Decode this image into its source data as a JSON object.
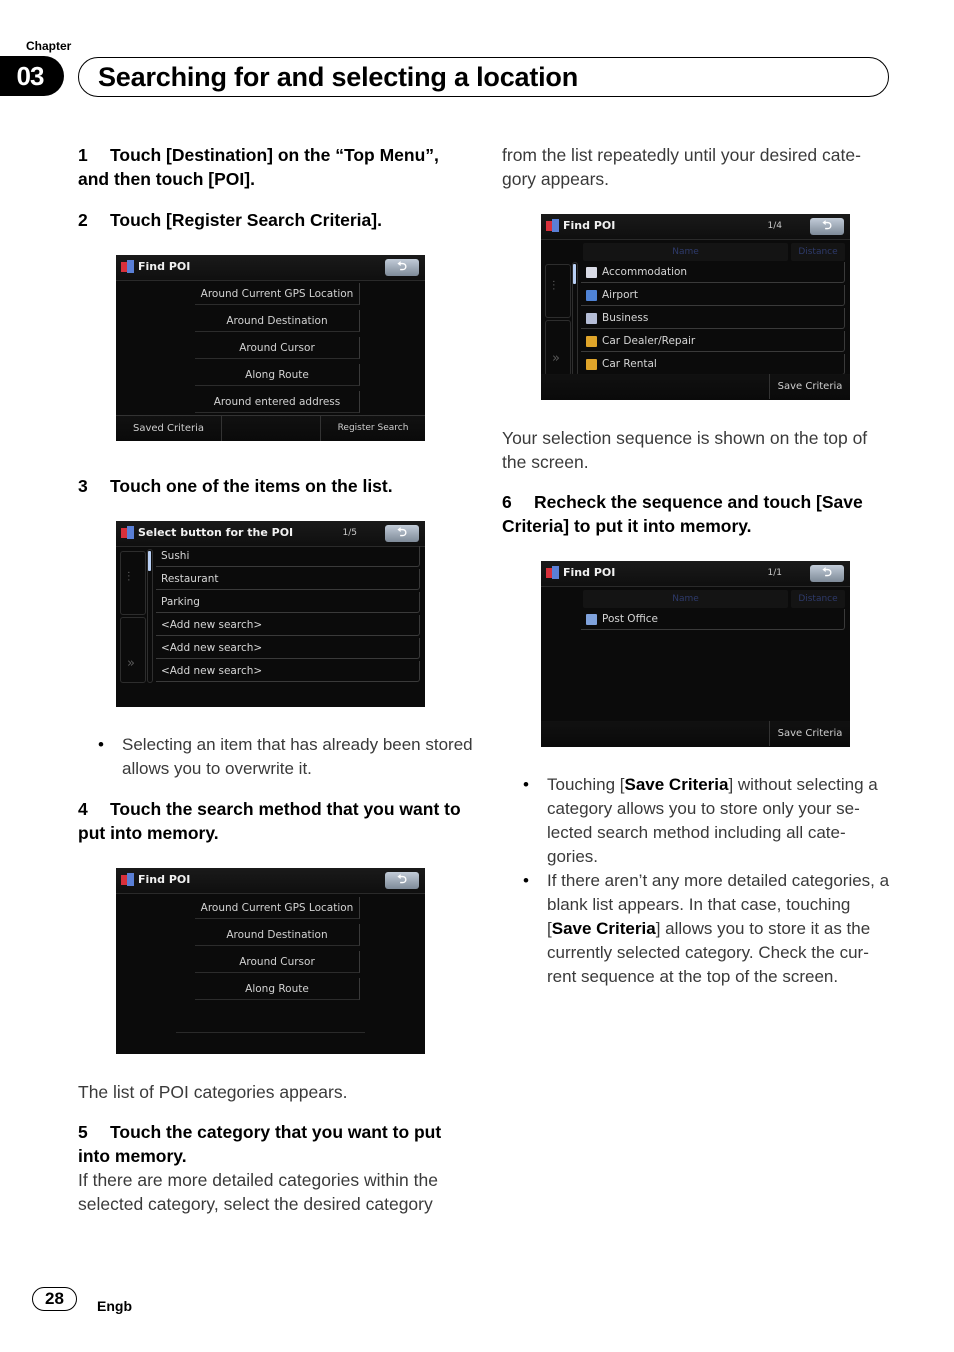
{
  "header": {
    "chapter_label": "Chapter",
    "chapter_number": "03",
    "title": "Searching for and selecting a location"
  },
  "left_column": {
    "step1": {
      "num": "1",
      "text": "Touch [Destination] on the “Top Menu”, and then touch [POI]."
    },
    "step2": {
      "num": "2",
      "text": "Touch [Register Search Criteria]."
    },
    "step3": {
      "num": "3",
      "text": "Touch one of the items on the list."
    },
    "bullet3": "Selecting an item that has already been stored allows you to overwrite it.",
    "step4": {
      "num": "4",
      "text": "Touch the search method that you want to put into memory."
    },
    "after4": "The list of POI categories appears.",
    "step5": {
      "num": "5",
      "text": "Touch the category that you want to put into memory."
    },
    "step5_body": "If there are more detailed categories within the selected category, select the desired category"
  },
  "right_column": {
    "continued": "from the list repeatedly until your desired cate-gory appears.",
    "after_screen": "Your selection sequence is shown on the top of the screen.",
    "step6": {
      "num": "6",
      "text": "Recheck the sequence and touch [Save Criteria] to put it into memory."
    },
    "bullets": [
      {
        "pre": "Touching [",
        "bold": "Save Criteria",
        "post": "] without selecting a category allows you to store only your se-lected search method including all cate-gories."
      },
      {
        "pre": "If there aren’t any more detailed categories, a blank list appears. In that case, touching [",
        "bold": "Save Criteria",
        "post": "] allows you to store it as the currently selected category. Check the cur-rent sequence at the top of the screen."
      }
    ]
  },
  "screens": {
    "find_poi_1": {
      "title": "Find POI",
      "back_icon": "back-arrow-icon",
      "items": [
        "Around Current GPS Location",
        "Around Destination",
        "Around Cursor",
        "Along Route",
        "Around entered address"
      ],
      "bottom_left": "Saved Criteria",
      "bottom_right": "Register Search Criteria"
    },
    "select_button": {
      "title": "Select button for the POI",
      "page": "1/5",
      "items": [
        "Sushi",
        "Restaurant",
        "Parking",
        "<Add new search>",
        "<Add new search>",
        "<Add new search>"
      ]
    },
    "find_poi_2": {
      "title": "Find POI",
      "items": [
        "Around Current GPS Location",
        "Around Destination",
        "Around Cursor",
        "Along Route"
      ]
    },
    "categories": {
      "title": "Find POI",
      "page": "1/4",
      "col_name": "Name",
      "col_distance": "Distance",
      "items": [
        {
          "label": "Accommodation",
          "icon": "bed-icon",
          "color": "#d9dbe6"
        },
        {
          "label": "Airport",
          "icon": "airport-icon",
          "color": "#4f83d6"
        },
        {
          "label": "Business",
          "icon": "building-icon",
          "color": "#b5bdd6"
        },
        {
          "label": "Car Dealer/Repair",
          "icon": "car-icon",
          "color": "#e0a52a"
        },
        {
          "label": "Car Rental",
          "icon": "car-icon",
          "color": "#e0a52a"
        }
      ],
      "save_label": "Save Criteria"
    },
    "post_office": {
      "title": "Find POI",
      "page": "1/1",
      "col_name": "Name",
      "col_distance": "Distance",
      "items": [
        {
          "label": "Post Office",
          "icon": "post-office-icon",
          "color": "#7fa2dc"
        }
      ],
      "save_label": "Save Criteria"
    }
  },
  "footer": {
    "page_number": "28",
    "language": "Engb"
  }
}
